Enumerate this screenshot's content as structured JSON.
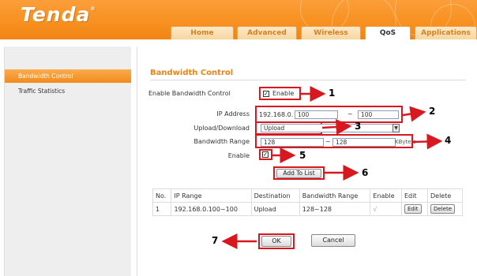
{
  "header": {
    "logo": "Tenda",
    "logo_mark": "®",
    "tabs": [
      {
        "label": "Home",
        "active": false
      },
      {
        "label": "Advanced",
        "active": false
      },
      {
        "label": "Wireless",
        "active": false
      },
      {
        "label": "QoS",
        "active": true
      },
      {
        "label": "Applications",
        "active": false
      }
    ]
  },
  "nav": {
    "items": [
      {
        "label": "Bandwidth Control",
        "active": true
      },
      {
        "label": "Traffic Statistics",
        "active": false
      }
    ]
  },
  "form": {
    "title": "Bandwidth Control",
    "enable_label": "Enable Bandwidth Control",
    "enable_checkbox_text": "Enable",
    "ip_label": "IP Address",
    "ip_prefix": "192.168.0.",
    "ip_start": "100",
    "ip_sep": "~",
    "ip_end": "100",
    "updown_label": "Upload/Download",
    "updown_value": "Upload",
    "range_label": "Bandwidth Range",
    "range_min": "128",
    "range_sep": "~",
    "range_max": "128",
    "range_unit": "KByte/s",
    "entry_enable_label": "Enable",
    "add_button": "Add To List"
  },
  "table": {
    "headers": [
      "No.",
      "IP Range",
      "Destination",
      "Bandwidth Range",
      "Enable",
      "Edit",
      "Delete"
    ],
    "rows": [
      {
        "no": "1",
        "ip_range": "192.168.0.100~100",
        "destination": "Upload",
        "bandwidth": "128~128",
        "enable": "√",
        "edit": "Edit",
        "delete": "Delete"
      }
    ]
  },
  "buttons": {
    "ok": "OK",
    "cancel": "Cancel"
  },
  "annotations": {
    "n1": "1",
    "n2": "2",
    "n3": "3",
    "n4": "4",
    "n5": "5",
    "n6": "6",
    "n7": "7",
    "color": "#d8171e"
  },
  "colors": {
    "brand_orange": "#f7901e",
    "title_orange": "#ef8314",
    "highlight_red": "#d8171e"
  }
}
